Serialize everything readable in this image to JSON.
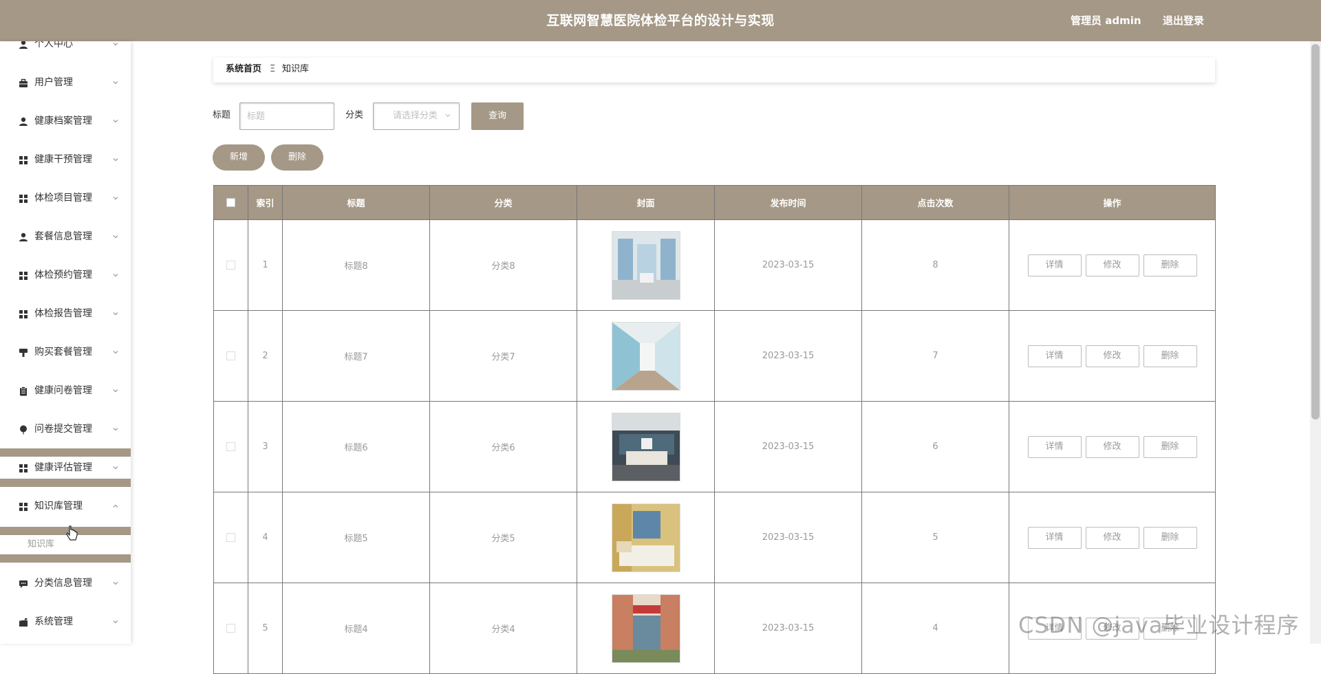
{
  "header": {
    "title": "互联网智慧医院体检平台的设计与实现",
    "user": "管理员 admin",
    "logout": "退出登录",
    "color": "#a59886"
  },
  "sidebar": {
    "items": [
      {
        "label": "个人中心",
        "icon": "person-icon"
      },
      {
        "label": "用户管理",
        "icon": "briefcase-icon"
      },
      {
        "label": "健康档案管理",
        "icon": "person-icon"
      },
      {
        "label": "健康干预管理",
        "icon": "grid-icon"
      },
      {
        "label": "体检项目管理",
        "icon": "grid-icon"
      },
      {
        "label": "套餐信息管理",
        "icon": "person-icon"
      },
      {
        "label": "体检预约管理",
        "icon": "grid-icon"
      },
      {
        "label": "体检报告管理",
        "icon": "grid-icon"
      },
      {
        "label": "购买套餐管理",
        "icon": "brush-icon"
      },
      {
        "label": "健康问卷管理",
        "icon": "clipboard-icon"
      },
      {
        "label": "问卷提交管理",
        "icon": "balloon-icon"
      },
      {
        "label": "健康评估管理",
        "icon": "grid-icon"
      },
      {
        "label": "知识库管理",
        "icon": "grid-icon"
      },
      {
        "label": "分类信息管理",
        "icon": "chat-icon"
      },
      {
        "label": "系统管理",
        "icon": "mailbox-icon"
      }
    ],
    "sub_item": "知识库"
  },
  "breadcrumb": {
    "home": "系统首页",
    "separator": "Ξ",
    "current": "知识库"
  },
  "search": {
    "title_label": "标题",
    "title_placeholder": "标题",
    "category_label": "分类",
    "category_placeholder": "请选择分类",
    "query_button": "查询"
  },
  "actions": {
    "add": "新增",
    "delete": "删除"
  },
  "table": {
    "headers": [
      "索引",
      "标题",
      "分类",
      "封面",
      "发布时间",
      "点击次数",
      "操作"
    ],
    "rows": [
      {
        "index": "1",
        "title": "标题8",
        "category": "分类8",
        "date": "2023-03-15",
        "clicks": "8"
      },
      {
        "index": "2",
        "title": "标题7",
        "category": "分类7",
        "date": "2023-03-15",
        "clicks": "7"
      },
      {
        "index": "3",
        "title": "标题6",
        "category": "分类6",
        "date": "2023-03-15",
        "clicks": "6"
      },
      {
        "index": "4",
        "title": "标题5",
        "category": "分类5",
        "date": "2023-03-15",
        "clicks": "5"
      },
      {
        "index": "5",
        "title": "标题4",
        "category": "分类4",
        "date": "2023-03-15",
        "clicks": "4"
      }
    ],
    "ops": {
      "detail": "详情",
      "edit": "修改",
      "delete": "删除"
    }
  },
  "watermark": "CSDN @java毕业设计程序"
}
